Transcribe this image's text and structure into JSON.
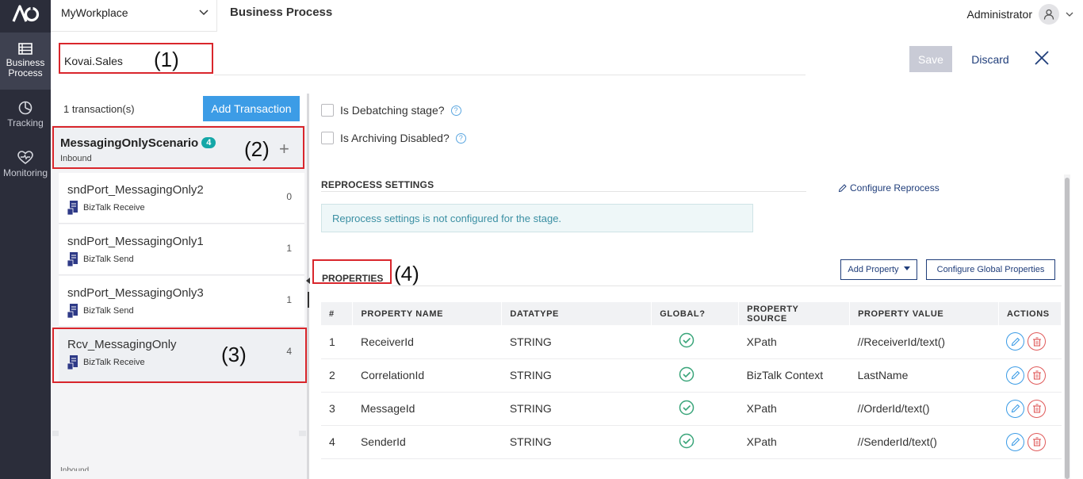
{
  "rail": {
    "items": [
      {
        "label_1": "Business",
        "label_2": "Process",
        "active": true
      },
      {
        "label_1": "Tracking"
      },
      {
        "label_1": "Monitoring"
      }
    ]
  },
  "topbar": {
    "workspace": "MyWorkplace",
    "title": "Business Process",
    "user": "Administrator"
  },
  "header": {
    "name_value": "Kovai.Sales",
    "annotation_1": "(1)",
    "save_label": "Save",
    "discard_label": "Discard"
  },
  "transactions": {
    "count_text": "1 transaction(s)",
    "add_label": "Add Transaction",
    "scenario": {
      "name": "MessagingOnlyScenario",
      "badge": "4",
      "direction": "Inbound",
      "annotation": "(2)",
      "plus": "+"
    },
    "ports": [
      {
        "name": "sndPort_MessagingOnly2",
        "type": "BizTalk Receive",
        "count": "0"
      },
      {
        "name": "sndPort_MessagingOnly1",
        "type": "BizTalk Send",
        "count": "1"
      },
      {
        "name": "sndPort_MessagingOnly3",
        "type": "BizTalk Send",
        "count": "1"
      },
      {
        "name": "Rcv_MessagingOnly",
        "type": "BizTalk Receive",
        "count": "4"
      }
    ],
    "selected_annotation": "(3)",
    "footer_text": "Inbound"
  },
  "stage": {
    "debatching_label": "Is Debatching stage?",
    "archiving_label": "Is Archiving Disabled?",
    "help_glyph": "?"
  },
  "reprocess": {
    "title": "REPROCESS SETTINGS",
    "configure_label": "Configure Reprocess",
    "info": "Reprocess settings is not configured for the stage."
  },
  "properties": {
    "title": "PROPERTIES",
    "annotation": "(4)",
    "add_label": "Add Property",
    "global_label": "Configure Global Properties",
    "columns": [
      "#",
      "PROPERTY NAME",
      "DATATYPE",
      "GLOBAL?",
      "PROPERTY SOURCE",
      "PROPERTY VALUE",
      "ACTIONS"
    ],
    "rows": [
      {
        "num": "1",
        "name": "ReceiverId",
        "datatype": "STRING",
        "source": "XPath",
        "value": "//ReceiverId/text()"
      },
      {
        "num": "2",
        "name": "CorrelationId",
        "datatype": "STRING",
        "source": "BizTalk Context",
        "value": "LastName"
      },
      {
        "num": "3",
        "name": "MessageId",
        "datatype": "STRING",
        "source": "XPath",
        "value": "//OrderId/text()"
      },
      {
        "num": "4",
        "name": "SenderId",
        "datatype": "STRING",
        "source": "XPath",
        "value": "//SenderId/text()"
      }
    ]
  },
  "colors": {
    "rail": "#2b2d3a",
    "primary": "#3c9ce6",
    "navy": "#1f3d7a",
    "highlight": "#d9262c",
    "badge": "#14a7a7",
    "check": "#3aa57a"
  }
}
